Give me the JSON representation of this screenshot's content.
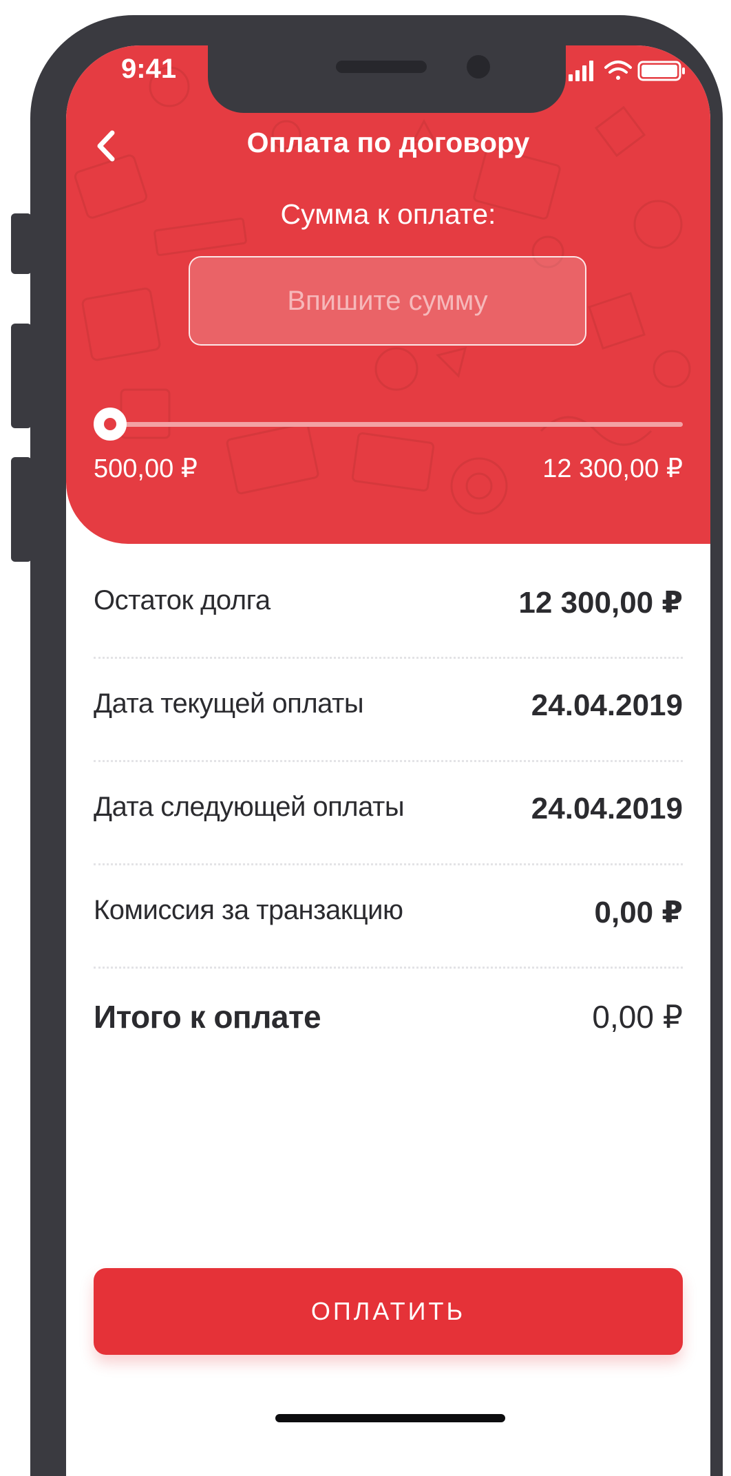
{
  "status_bar": {
    "time": "9:41",
    "icons": [
      "signal-icon",
      "wifi-icon",
      "battery-icon"
    ]
  },
  "header": {
    "title": "Оплата по договору",
    "back_icon": "chevron-left-icon"
  },
  "amount": {
    "label": "Сумма к оплате:",
    "value": "",
    "placeholder": "Впишите сумму"
  },
  "slider": {
    "min_label": "500,00 ₽",
    "max_label": "12 300,00 ₽",
    "value_fraction": 0
  },
  "details": [
    {
      "label": "Остаток долга",
      "value": "12 300,00 ₽"
    },
    {
      "label": "Дата текущей оплаты",
      "value": "24.04.2019"
    },
    {
      "label": "Дата следующей оплаты",
      "value": "24.04.2019"
    },
    {
      "label": "Комиссия за транзакцию",
      "value": "0,00 ₽"
    }
  ],
  "total": {
    "label": "Итого к оплате",
    "value": "0,00 ₽"
  },
  "pay_button": {
    "label": "ОПЛАТИТЬ"
  },
  "colors": {
    "accent": "#e53c42",
    "button": "#e53238",
    "frame": "#3a3a40",
    "text": "#2b2b2f"
  }
}
